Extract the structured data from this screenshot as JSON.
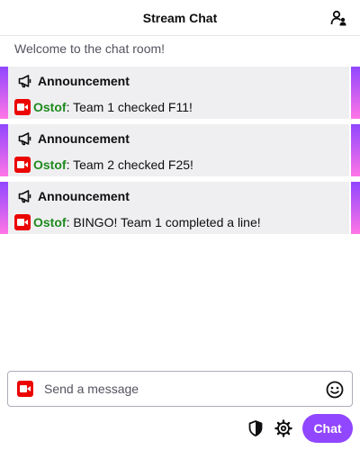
{
  "header": {
    "title": "Stream Chat",
    "users_icon": "community-users-icon"
  },
  "welcome_message": "Welcome to the chat room!",
  "announcements": [
    {
      "title": "Announcement",
      "username": "Ostof",
      "separator": ":",
      "text": " Team 1 checked F11!"
    },
    {
      "title": "Announcement",
      "username": "Ostof",
      "separator": ":",
      "text": " Team 2 checked F25!"
    },
    {
      "title": "Announcement",
      "username": "Ostof",
      "separator": ":",
      "text": " BINGO! Team 1 completed a line!"
    }
  ],
  "input": {
    "placeholder": "Send a message",
    "value": ""
  },
  "footer": {
    "chat_button_label": "Chat",
    "mod_icon": "shield-icon",
    "settings_icon": "gear-icon"
  },
  "colors": {
    "accent": "#9146ff",
    "username": "#1e8a1e",
    "broadcaster_badge": "#eb0400",
    "announcement_bg": "#efeff1"
  }
}
